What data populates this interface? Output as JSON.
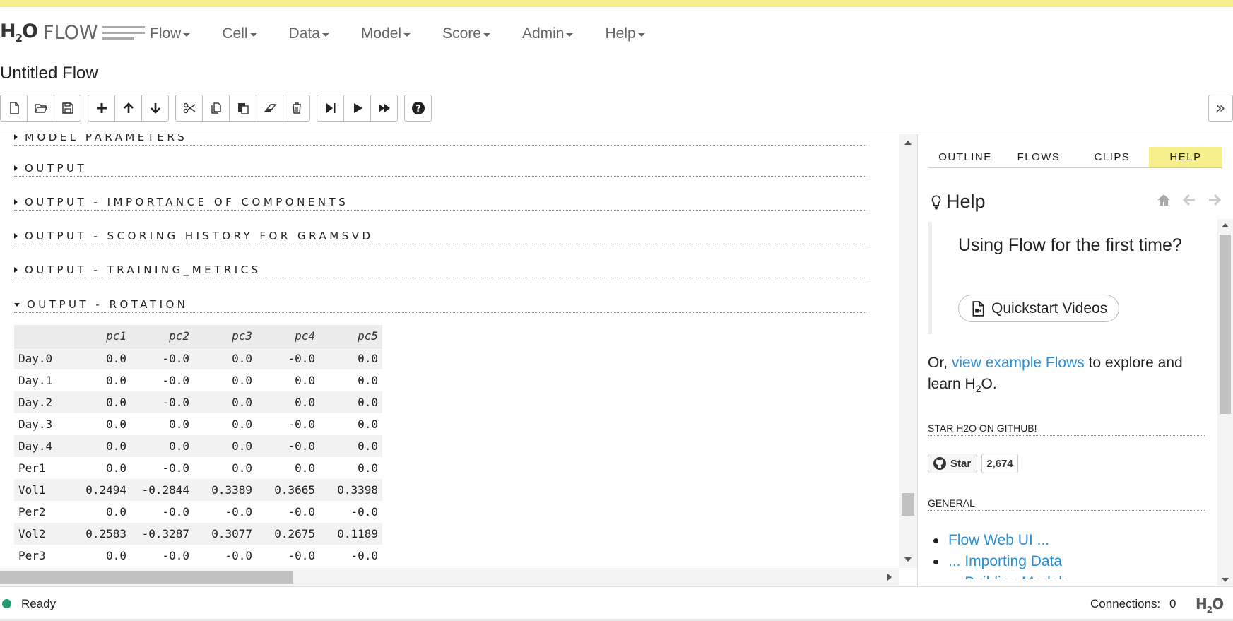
{
  "app": {
    "logo_h": "H",
    "logo_2": "2",
    "logo_o": "O",
    "logo_flow": "FLOW",
    "flow_title": "Untitled Flow"
  },
  "menu": [
    {
      "label": "Flow"
    },
    {
      "label": "Cell"
    },
    {
      "label": "Data"
    },
    {
      "label": "Model"
    },
    {
      "label": "Score"
    },
    {
      "label": "Admin"
    },
    {
      "label": "Help"
    }
  ],
  "toolbar": {
    "groups": [
      [
        "new-file-icon",
        "open-folder-icon",
        "save-icon"
      ],
      [
        "plus-icon",
        "arrow-up-icon",
        "arrow-down-icon"
      ],
      [
        "scissors-icon",
        "copy-icon",
        "paste-icon",
        "eraser-icon",
        "trash-icon"
      ],
      [
        "step-forward-icon",
        "play-icon",
        "fast-forward-icon"
      ],
      [
        "question-circle-icon"
      ]
    ],
    "expand_label": "»"
  },
  "sections": [
    {
      "label": "MODEL PARAMETERS",
      "expanded": false
    },
    {
      "label": "OUTPUT",
      "expanded": false
    },
    {
      "label": "OUTPUT - IMPORTANCE OF COMPONENTS",
      "expanded": false
    },
    {
      "label": "OUTPUT - SCORING HISTORY FOR GRAMSVD",
      "expanded": false
    },
    {
      "label": "OUTPUT - TRAINING_METRICS",
      "expanded": false
    },
    {
      "label": "OUTPUT - ROTATION",
      "expanded": true
    }
  ],
  "rotation_table": {
    "columns": [
      "",
      "pc1",
      "pc2",
      "pc3",
      "pc4",
      "pc5"
    ],
    "rows": [
      [
        "Day.0",
        "0.0",
        "-0.0",
        "0.0",
        "-0.0",
        "0.0"
      ],
      [
        "Day.1",
        "0.0",
        "-0.0",
        "0.0",
        "0.0",
        "0.0"
      ],
      [
        "Day.2",
        "0.0",
        "-0.0",
        "0.0",
        "0.0",
        "0.0"
      ],
      [
        "Day.3",
        "0.0",
        "0.0",
        "0.0",
        "-0.0",
        "0.0"
      ],
      [
        "Day.4",
        "0.0",
        "0.0",
        "0.0",
        "-0.0",
        "0.0"
      ],
      [
        "Per1",
        "0.0",
        "-0.0",
        "0.0",
        "0.0",
        "0.0"
      ],
      [
        "Vol1",
        "0.2494",
        "-0.2844",
        "0.3389",
        "0.3665",
        "0.3398"
      ],
      [
        "Per2",
        "0.0",
        "-0.0",
        "-0.0",
        "-0.0",
        "-0.0"
      ],
      [
        "Vol2",
        "0.2583",
        "-0.3287",
        "0.3077",
        "0.2675",
        "0.1189"
      ],
      [
        "Per3",
        "0.0",
        "-0.0",
        "-0.0",
        "-0.0",
        "-0.0"
      ]
    ]
  },
  "sidebar": {
    "tabs": [
      {
        "label": "OUTLINE",
        "active": false
      },
      {
        "label": "FLOWS",
        "active": false
      },
      {
        "label": "CLIPS",
        "active": false
      },
      {
        "label": "HELP",
        "active": true
      }
    ],
    "help_title": "Help",
    "callout_title": "Using Flow for the first time?",
    "quickstart_label": "Quickstart Videos",
    "or_prefix": "Or, ",
    "or_link": "view example Flows",
    "or_suffix": " to explore and learn H",
    "or_sub": "2",
    "or_end": "O.",
    "github_heading": "STAR H2O ON GITHUB!",
    "star_label": "Star",
    "star_count": "2,674",
    "general_heading": "GENERAL",
    "general_links": [
      "Flow Web UI ...",
      "... Importing Data",
      "... Building Models"
    ]
  },
  "status": {
    "state": "Ready",
    "connections_label": "Connections:",
    "connections_value": "0",
    "logo_h": "H",
    "logo_2": "2",
    "logo_o": "O"
  },
  "colors": {
    "accent_yellow": "#f7ef8b",
    "link_blue": "#2b8fd6",
    "status_green": "#1e9b6b"
  }
}
